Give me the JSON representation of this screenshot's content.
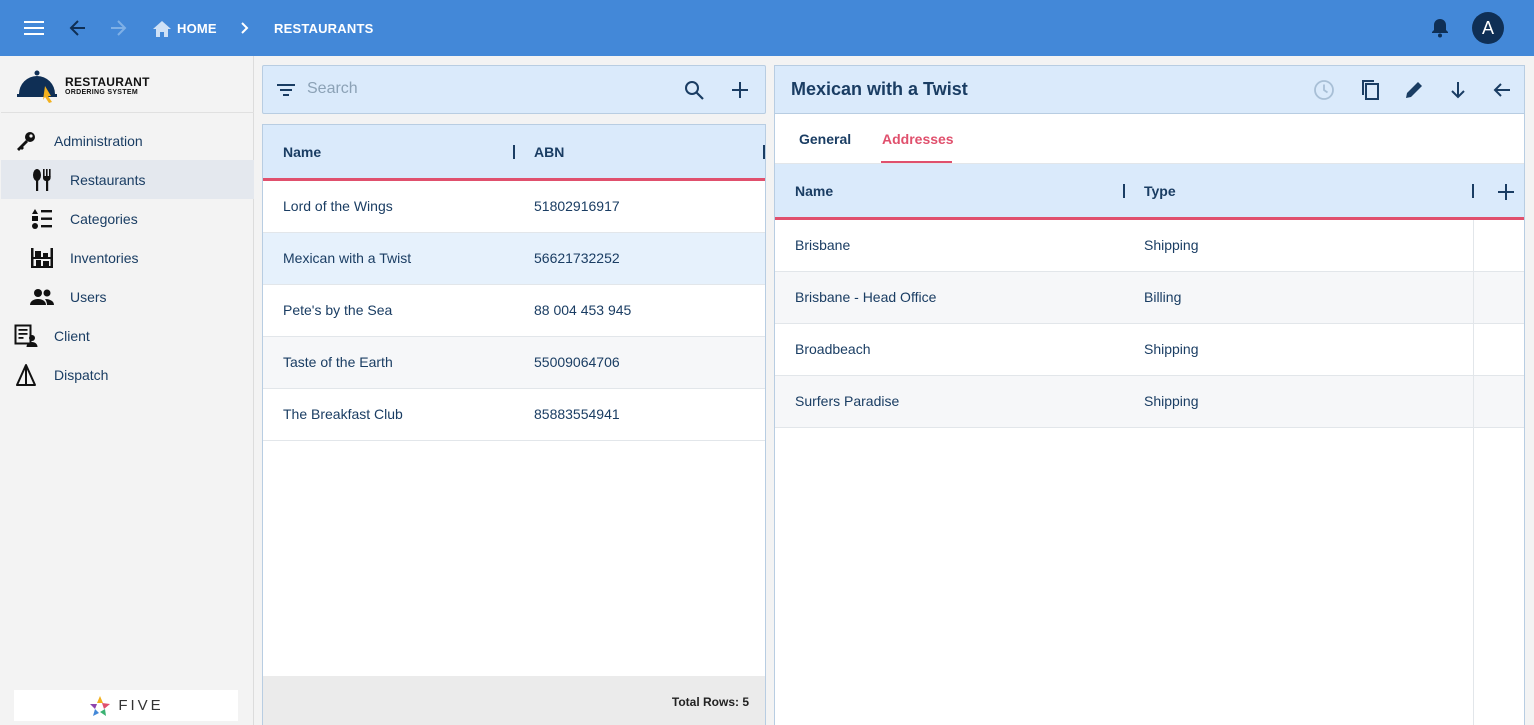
{
  "topbar": {
    "breadcrumb_home": "HOME",
    "breadcrumb_current": "RESTAURANTS",
    "avatar_initial": "A",
    "bar_color": "#4388d8"
  },
  "sidebar": {
    "logo_line1": "RESTAURANT",
    "logo_line2": "ORDERING SYSTEM",
    "items": [
      {
        "label": "Administration",
        "icon": "key-icon"
      },
      {
        "label": "Restaurants",
        "icon": "cutlery-icon",
        "active": true
      },
      {
        "label": "Categories",
        "icon": "list-icon"
      },
      {
        "label": "Inventories",
        "icon": "shelves-icon"
      },
      {
        "label": "Users",
        "icon": "users-icon"
      },
      {
        "label": "Client",
        "icon": "client-icon"
      },
      {
        "label": "Dispatch",
        "icon": "dispatch-icon"
      }
    ],
    "footer_brand": "FIVE"
  },
  "list": {
    "search_placeholder": "Search",
    "columns": [
      "Name",
      "ABN"
    ],
    "rows": [
      {
        "name": "Lord of the Wings",
        "abn": "51802916917"
      },
      {
        "name": "Mexican with a Twist",
        "abn": "56621732252"
      },
      {
        "name": "Pete's by the Sea",
        "abn": "88 004 453 945"
      },
      {
        "name": "Taste of the Earth",
        "abn": "55009064706"
      },
      {
        "name": "The Breakfast Club",
        "abn": "85883554941"
      }
    ],
    "selected_index": 1,
    "total_rows": "Total Rows: 5"
  },
  "detail": {
    "title": "Mexican with a Twist",
    "tabs": [
      "General",
      "Addresses"
    ],
    "active_tab": "Addresses",
    "columns": [
      "Name",
      "Type"
    ],
    "rows": [
      {
        "name": "Brisbane",
        "type": "Shipping"
      },
      {
        "name": "Brisbane - Head Office",
        "type": "Billing"
      },
      {
        "name": "Broadbeach",
        "type": "Shipping"
      },
      {
        "name": "Surfers Paradise",
        "type": "Shipping"
      }
    ],
    "accent_color": "#e0506d"
  }
}
